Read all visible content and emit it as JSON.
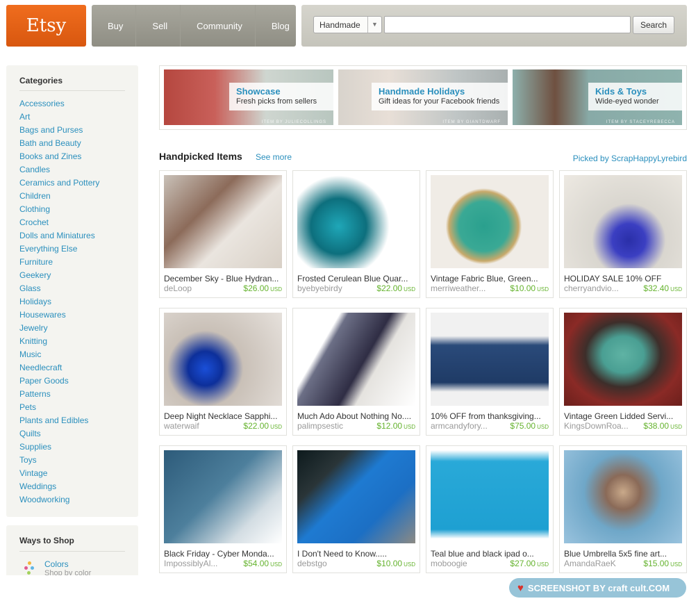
{
  "header": {
    "logo": "Etsy",
    "nav": [
      "Buy",
      "Sell",
      "Community",
      "Blog"
    ],
    "search_select": "Handmade",
    "search_value": "",
    "search_button": "Search"
  },
  "sidebar": {
    "title": "Categories",
    "categories": [
      "Accessories",
      "Art",
      "Bags and Purses",
      "Bath and Beauty",
      "Books and Zines",
      "Candles",
      "Ceramics and Pottery",
      "Children",
      "Clothing",
      "Crochet",
      "Dolls and Miniatures",
      "Everything Else",
      "Furniture",
      "Geekery",
      "Glass",
      "Holidays",
      "Housewares",
      "Jewelry",
      "Knitting",
      "Music",
      "Needlecraft",
      "Paper Goods",
      "Patterns",
      "Pets",
      "Plants and Edibles",
      "Quilts",
      "Supplies",
      "Toys",
      "Vintage",
      "Weddings",
      "Woodworking"
    ]
  },
  "ways": {
    "title": "Ways to Shop",
    "link": "Colors",
    "sub": "Shop by color"
  },
  "banners": [
    {
      "title": "Showcase",
      "subtitle": "Fresh picks from sellers",
      "credit": "ITEM BY JULIECOLLINGS",
      "color": "#a8b8b0"
    },
    {
      "title": "Handmade Holidays",
      "subtitle": "Gift ideas for your Facebook friends",
      "credit": "ITEM BY GIANTDWARF",
      "color": "#9aa4a6"
    },
    {
      "title": "Kids & Toys",
      "subtitle": "Wide-eyed wonder",
      "credit": "ITEM BY STACEYREBECCA",
      "color": "#7fa3a0"
    }
  ],
  "handpicked": {
    "title": "Handpicked Items",
    "see_more": "See more",
    "picked_by": "Picked by ScrapHappyLyrebird",
    "currency": "USD",
    "items": [
      {
        "title": "December Sky - Blue Hydran...",
        "shop": "deLoop",
        "price": "$26.00"
      },
      {
        "title": "Frosted Cerulean Blue Quar...",
        "shop": "byebyebirdy",
        "price": "$22.00"
      },
      {
        "title": "Vintage Fabric Blue, Green...",
        "shop": "merriweather...",
        "price": "$10.00"
      },
      {
        "title": "HOLIDAY SALE 10% OFF",
        "shop": "cherryandvio...",
        "price": "$32.40"
      },
      {
        "title": "Deep Night Necklace Sapphi...",
        "shop": "waterwaif",
        "price": "$22.00"
      },
      {
        "title": "Much Ado About Nothing No....",
        "shop": "palimpsestic",
        "price": "$12.00"
      },
      {
        "title": "10% OFF from thanksgiving...",
        "shop": "armcandyfory...",
        "price": "$75.00"
      },
      {
        "title": "Vintage Green Lidded Servi...",
        "shop": "KingsDownRoa...",
        "price": "$38.00"
      },
      {
        "title": "Black Friday - Cyber Monda...",
        "shop": "ImpossiblyAl...",
        "price": "$54.00"
      },
      {
        "title": "I Don't Need to Know.....",
        "shop": "debstgo",
        "price": "$10.00"
      },
      {
        "title": "Teal blue and black ipad o...",
        "shop": "moboogie",
        "price": "$27.00"
      },
      {
        "title": "Blue Umbrella 5x5 fine art...",
        "shop": "AmandaRaeK",
        "price": "$15.00"
      }
    ]
  },
  "watermark": "SCREENSHOT BY craft cult.COM",
  "colors": {
    "accent": "#2a8fbd",
    "price": "#65b32e",
    "logo": "#e8621a"
  }
}
